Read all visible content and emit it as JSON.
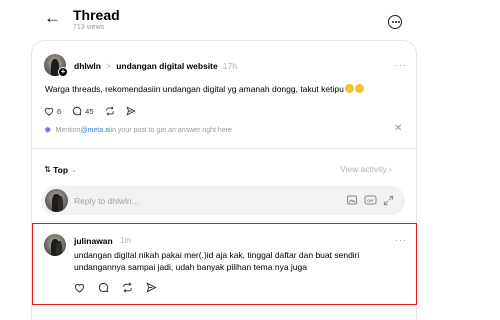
{
  "header": {
    "back_icon": "arrow-left-icon",
    "title": "Thread",
    "views": "713 views",
    "more_icon": "ellipsis-circle-icon"
  },
  "post": {
    "username": "dhlwln",
    "separator": ">",
    "community": "undangan digital website",
    "time": "17h",
    "text": "Warga threads, rekomendasiin undangan digital yg amanah dongg, takut ketipu",
    "likes": "6",
    "replies": "45",
    "more": "···"
  },
  "mention_hint": {
    "prefix": "Mention ",
    "handle": "@meta.ai",
    "suffix": " in your post to get an answer right here",
    "close": "✕"
  },
  "sort": {
    "label": "Top",
    "view_activity": "View activity"
  },
  "reply_box": {
    "placeholder": "Reply to dhlwln..."
  },
  "comment": {
    "username": "julinawan",
    "time": "1m",
    "text": "undangan digital nikah pakai mer(.)id aja kak, tinggal daftar dan buat sendiri undangannya sampai jadi, udah banyak pilihan tema nya juga",
    "more": "···"
  },
  "colors": {
    "highlight_border": "#e02020",
    "link": "#2f80ed",
    "muted": "#999999"
  }
}
